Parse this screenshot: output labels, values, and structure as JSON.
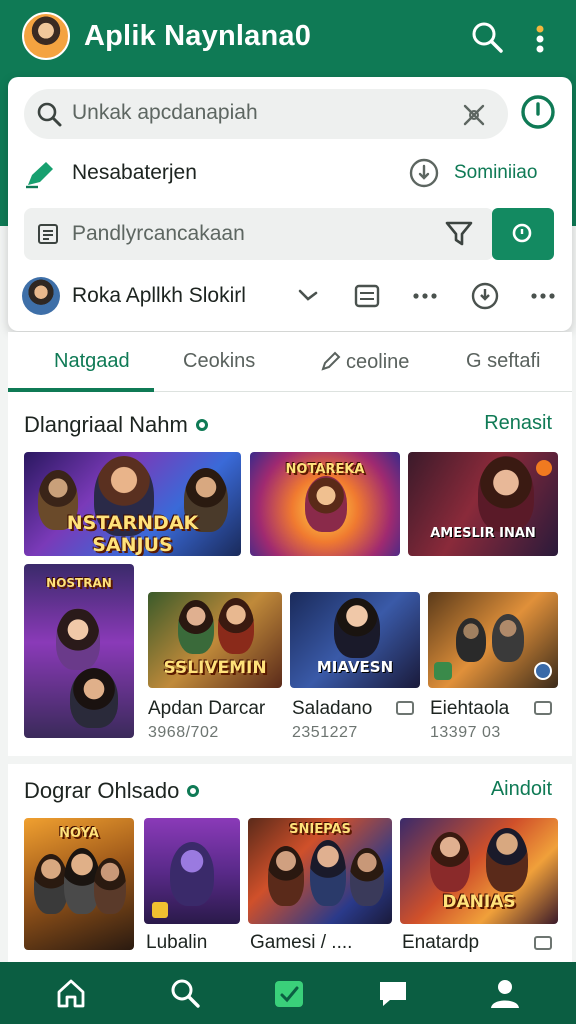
{
  "app": {
    "title": "Aplik Naynlana0",
    "accent": "#0f7a55",
    "header_bg": "#0f7a55",
    "nav_bg": "#0b5e42"
  },
  "header": {
    "icons": [
      "avatar",
      "search-icon",
      "more-vert-icon"
    ]
  },
  "card": {
    "search_placeholder": "Unkak apcdanapiah",
    "row2_label": "Nesabaterjen",
    "row2_link": "Sominiiao",
    "filter_placeholder": "Pandlyrcancakaan",
    "row4_label": "Roka Apllkh Slokirl"
  },
  "tabs": [
    {
      "label": "Natgaad",
      "active": true
    },
    {
      "label": "Ceokins",
      "active": false
    },
    {
      "label": "ceoline",
      "active": false
    },
    {
      "label": "G seftafi",
      "active": false
    }
  ],
  "section1": {
    "title": "Dlangriaal Nahm",
    "link": "Renasit",
    "banners": [
      {
        "art": "NSTARNDAK SANJUS"
      },
      {
        "art": "NOTAREKA"
      },
      {
        "art": "AMESLIR INAN"
      },
      {
        "art": "NOSTRAN"
      }
    ],
    "games": [
      {
        "art": "SSLIVEMIN",
        "title": "Apdan Darcar",
        "sub": "3968/702"
      },
      {
        "art": "MIAVESN",
        "title": "Saladano",
        "sub": "2351227"
      },
      {
        "art": "",
        "title": "Eiehtaola",
        "sub": "13397 03"
      }
    ]
  },
  "section2": {
    "title": "Dograr Ohlsado",
    "link": "Aindoit",
    "games": [
      {
        "art": "NOYA",
        "title": ""
      },
      {
        "art": "",
        "title": "Lubalin"
      },
      {
        "art": "SNIEPAS",
        "title": "Gamesi / ...."
      },
      {
        "art": "DANIAS",
        "title": "Enatardp"
      }
    ]
  },
  "bottom_nav": [
    "home-icon",
    "search-icon",
    "store-icon",
    "chat-icon",
    "profile-icon"
  ]
}
